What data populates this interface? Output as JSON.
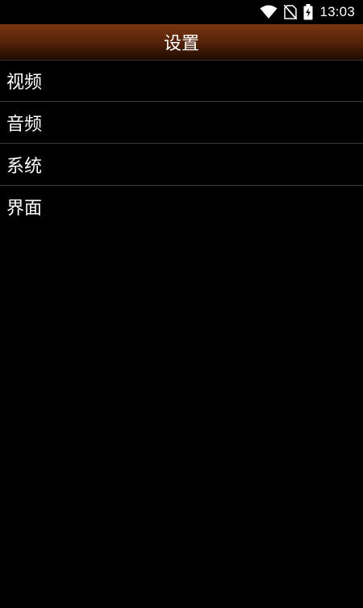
{
  "status_bar": {
    "time": "13:03",
    "icons": [
      "wifi-icon",
      "no-sim-icon",
      "battery-charging-icon"
    ]
  },
  "title_bar": {
    "title": "设置"
  },
  "menu": {
    "items": [
      {
        "label": "视频"
      },
      {
        "label": "音频"
      },
      {
        "label": "系统"
      },
      {
        "label": "界面"
      }
    ]
  },
  "colors": {
    "background": "#000000",
    "title_bar_top": "#7a3512",
    "title_bar_bottom": "#1a0a02",
    "divider": "#3a3a3a",
    "text": "#ffffff"
  }
}
